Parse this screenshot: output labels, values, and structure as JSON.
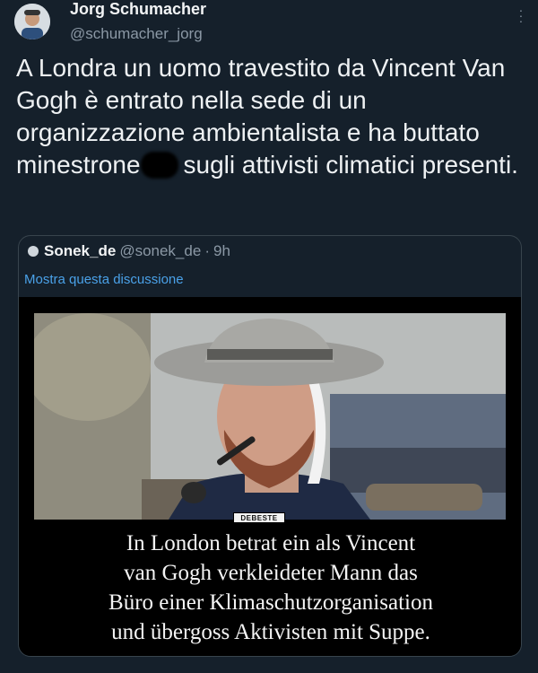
{
  "author": {
    "name": "Jorg Schumacher",
    "handle": "@schumacher_jorg",
    "avatar_icon": "user-avatar"
  },
  "tweet": {
    "text_before_redaction": "A Londra un uomo travestito da Vincent Van Gogh è entrato nella sede di un organizzazione ambientalista e ha buttato minestrone",
    "text_after_redaction": "sugli attivisti climatici presenti."
  },
  "quoted_tweet": {
    "name": "Sonek_de",
    "handle": "@sonek_de",
    "separator": "·",
    "time": "9h",
    "show_thread": "Mostra questa discussione",
    "media": {
      "watermark": "DEBESTE",
      "caption_lines": [
        "In London betrat ein als Vincent",
        "van Gogh verkleideter Mann das",
        "Büro einer Klimaschutzorganisation",
        "und übergoss Aktivisten mit Suppe."
      ]
    }
  },
  "colors": {
    "background": "#15202b",
    "link": "#4aa1e8",
    "secondary_text": "#8b98a5"
  }
}
